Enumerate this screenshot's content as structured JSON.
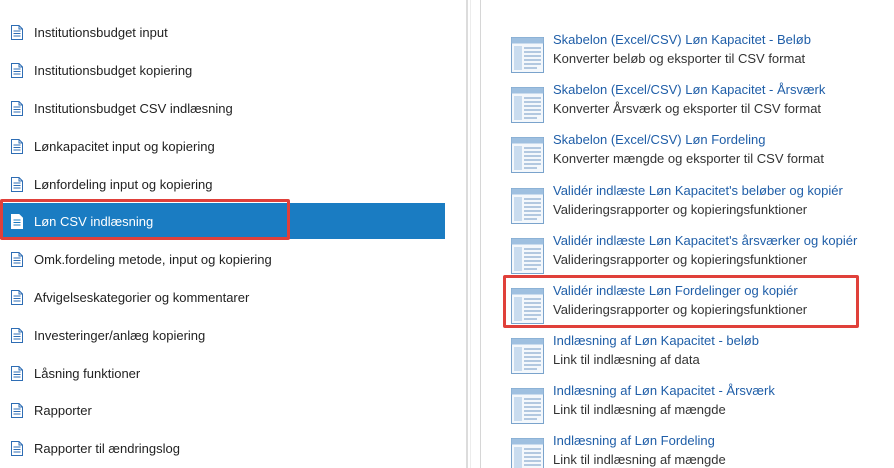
{
  "left_menu": {
    "items": [
      {
        "label": "Institutionsbudget input",
        "selected": false
      },
      {
        "label": "Institutionsbudget kopiering",
        "selected": false
      },
      {
        "label": "Institutionsbudget CSV indlæsning",
        "selected": false
      },
      {
        "label": "Lønkapacitet input og kopiering",
        "selected": false
      },
      {
        "label": "Lønfordeling input og kopiering",
        "selected": false
      },
      {
        "label": "Løn CSV indlæsning",
        "selected": true
      },
      {
        "label": "Omk.fordeling metode, input og kopiering",
        "selected": false
      },
      {
        "label": "Afvigelseskategorier og kommentarer",
        "selected": false
      },
      {
        "label": "Investeringer/anlæg kopiering",
        "selected": false
      },
      {
        "label": "Låsning funktioner",
        "selected": false
      },
      {
        "label": "Rapporter",
        "selected": false
      },
      {
        "label": "Rapporter til ændringslog",
        "selected": false
      }
    ]
  },
  "right_panel": {
    "items": [
      {
        "title": "Skabelon (Excel/CSV) Løn Kapacitet - Beløb",
        "description": "Konverter beløb og eksporter til CSV format"
      },
      {
        "title": "Skabelon (Excel/CSV) Løn Kapacitet - Årsværk",
        "description": "Konverter Årsværk og eksporter til CSV format"
      },
      {
        "title": "Skabelon (Excel/CSV) Løn Fordeling",
        "description": "Konverter mængde og eksporter til CSV format"
      },
      {
        "title": "Validér indlæste Løn Kapacitet's beløber og kopiér",
        "description": "Valideringsrapporter og kopieringsfunktioner"
      },
      {
        "title": "Validér indlæste Løn Kapacitet's årsværker og kopiér",
        "description": "Valideringsrapporter og kopieringsfunktioner"
      },
      {
        "title": "Validér indlæste Løn Fordelinger og kopiér",
        "description": "Valideringsrapporter og kopieringsfunktioner"
      },
      {
        "title": "Indlæsning af Løn Kapacitet - beløb",
        "description": "Link til indlæsning af data"
      },
      {
        "title": "Indlæsning af Løn Kapacitet - Årsværk",
        "description": "Link til indlæsning af mængde"
      },
      {
        "title": "Indlæsning af Løn Fordeling",
        "description": "Link til indlæsning af mængde"
      }
    ]
  },
  "colors": {
    "selected_bg": "#1a7cc2",
    "link": "#1f5ea8",
    "highlight": "#e0403a"
  },
  "icons": {
    "menu_item": "document-icon",
    "template_item": "spreadsheet-template-icon"
  }
}
